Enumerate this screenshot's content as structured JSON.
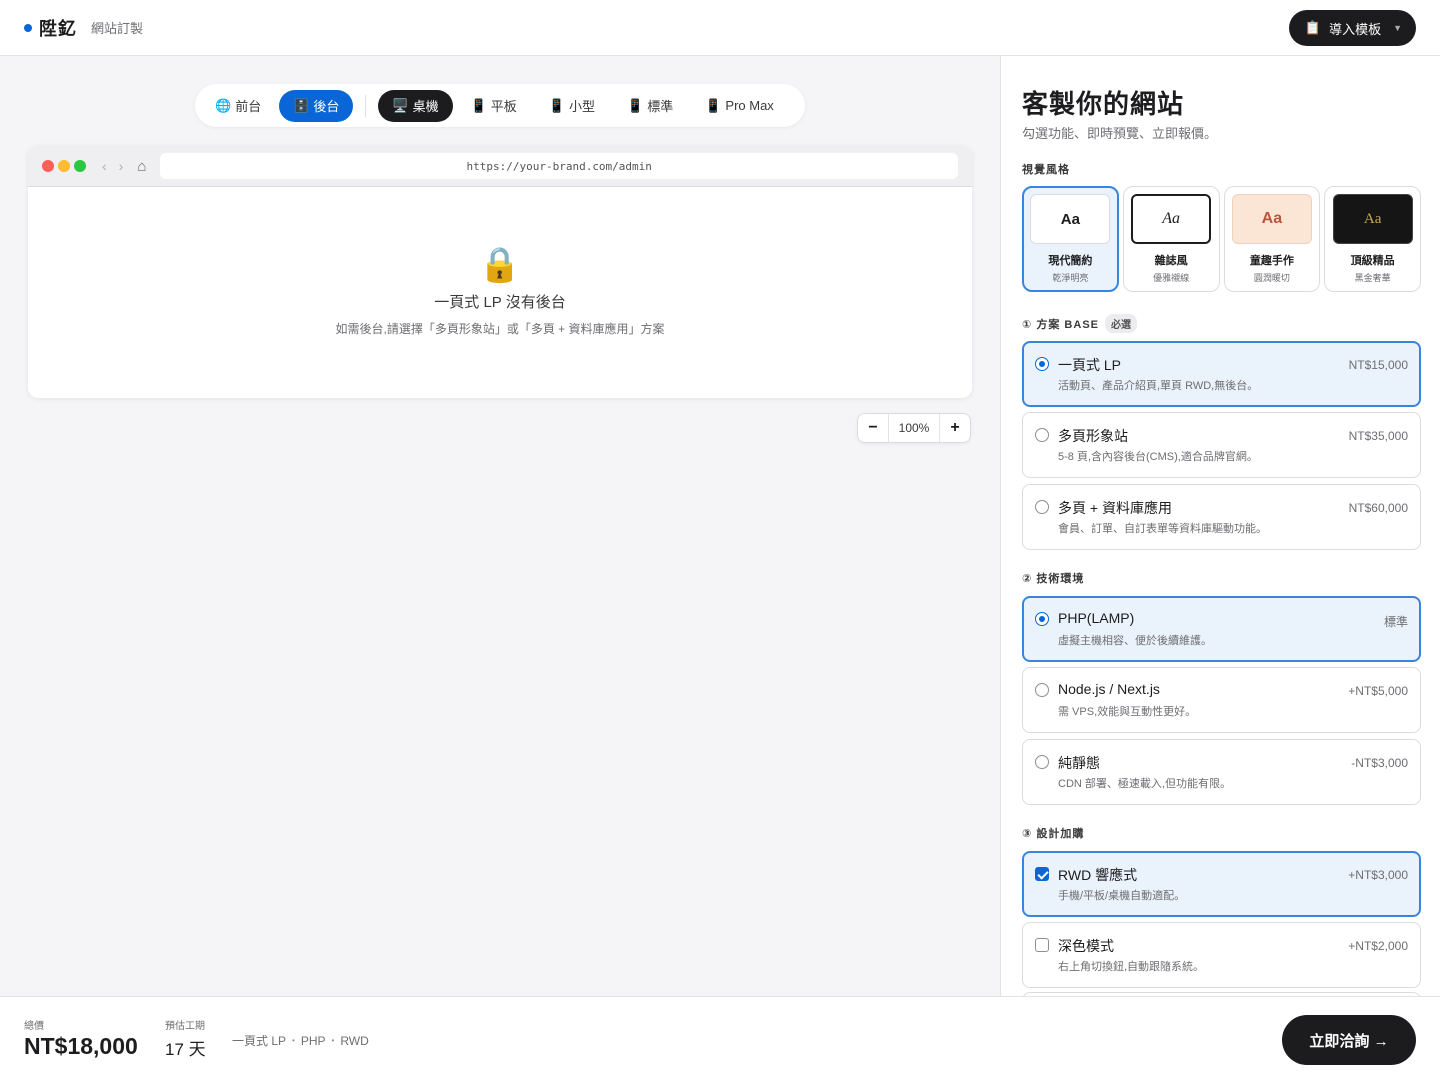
{
  "header": {
    "brand_name": "陞釔",
    "brand_sub": "網站訂製",
    "import_label": "導入模板",
    "import_icon": "clipboard-icon"
  },
  "preview": {
    "device_tabs": [
      {
        "icon": "🌐",
        "label": "前台"
      },
      {
        "icon": "🗄️",
        "label": "後台"
      },
      {
        "icon": "🖥️",
        "label": "桌機"
      },
      {
        "icon": "📱",
        "label": "平板"
      },
      {
        "icon": "📱",
        "label": "小型"
      },
      {
        "icon": "📱",
        "label": "標準"
      },
      {
        "icon": "📱",
        "label": "Pro Max"
      }
    ],
    "active_view": "後台",
    "active_device": "桌機",
    "url": "https://your-brand.com/admin",
    "empty_icon": "🔒",
    "empty_title": "一頁式 LP 沒有後台",
    "empty_desc": "如需後台,請選擇「多頁形象站」或「多頁 + 資料庫應用」方案",
    "zoom_minus": "−",
    "zoom_value": "100%",
    "zoom_plus": "+",
    "traffic_colors": [
      "#ff5f57",
      "#febc2e",
      "#28c840"
    ]
  },
  "panel": {
    "title": "客製你的網站",
    "subtitle": "勾選功能、即時預覽、立即報價。",
    "style_section": "視覺風格",
    "styles": [
      {
        "sample": "Aa",
        "name": "現代簡約",
        "desc": "乾淨明亮",
        "selected": true
      },
      {
        "sample": "Aa",
        "name": "雜誌風",
        "desc": "優雅襯線",
        "selected": false
      },
      {
        "sample": "Aa",
        "name": "童趣手作",
        "desc": "圓潤暖切",
        "selected": false
      },
      {
        "sample": "Aa",
        "name": "頂級精品",
        "desc": "黑金奢華",
        "selected": false
      }
    ],
    "base_section": "① 方案 BASE",
    "base_required": "必選",
    "base_options": [
      {
        "name": "一頁式 LP",
        "desc": "活動頁、產品介紹頁,單頁 RWD,無後台。",
        "price": "NT$15,000",
        "selected": true
      },
      {
        "name": "多頁形象站",
        "desc": "5-8 頁,含內容後台(CMS),適合品牌官網。",
        "price": "NT$35,000",
        "selected": false
      },
      {
        "name": "多頁 + 資料庫應用",
        "desc": "會員、訂單、自訂表單等資料庫驅動功能。",
        "price": "NT$60,000",
        "selected": false
      }
    ],
    "tech_section": "② 技術環境",
    "tech_options": [
      {
        "name": "PHP(LAMP)",
        "desc": "虛擬主機相容、便於後續維護。",
        "price": "標準",
        "selected": true
      },
      {
        "name": "Node.js / Next.js",
        "desc": "需 VPS,效能與互動性更好。",
        "price": "+NT$5,000",
        "selected": false
      },
      {
        "name": "純靜態",
        "desc": "CDN 部署、極速載入,但功能有限。",
        "price": "-NT$3,000",
        "selected": false
      }
    ],
    "design_section": "③ 設計加購",
    "design_options": [
      {
        "name": "RWD 響應式",
        "desc": "手機/平板/桌機自動適配。",
        "price": "+NT$3,000",
        "selected": true
      },
      {
        "name": "深色模式",
        "desc": "右上角切換鈕,自動跟隨系統。",
        "price": "+NT$2,000",
        "selected": false
      }
    ]
  },
  "footer": {
    "total_label": "總價",
    "total_value": "NT$18,000",
    "days_label": "預估工期",
    "days_value": "17 天",
    "summary": [
      "一頁式 LP",
      "PHP",
      "RWD"
    ],
    "summary_sep": "•",
    "cta_label": "立即洽詢 →"
  },
  "colors": {
    "accent": "#0a66d6",
    "dark": "#1c1c1e",
    "selected_bg": "#eaf2fc",
    "selected_border": "#3a84dd"
  }
}
